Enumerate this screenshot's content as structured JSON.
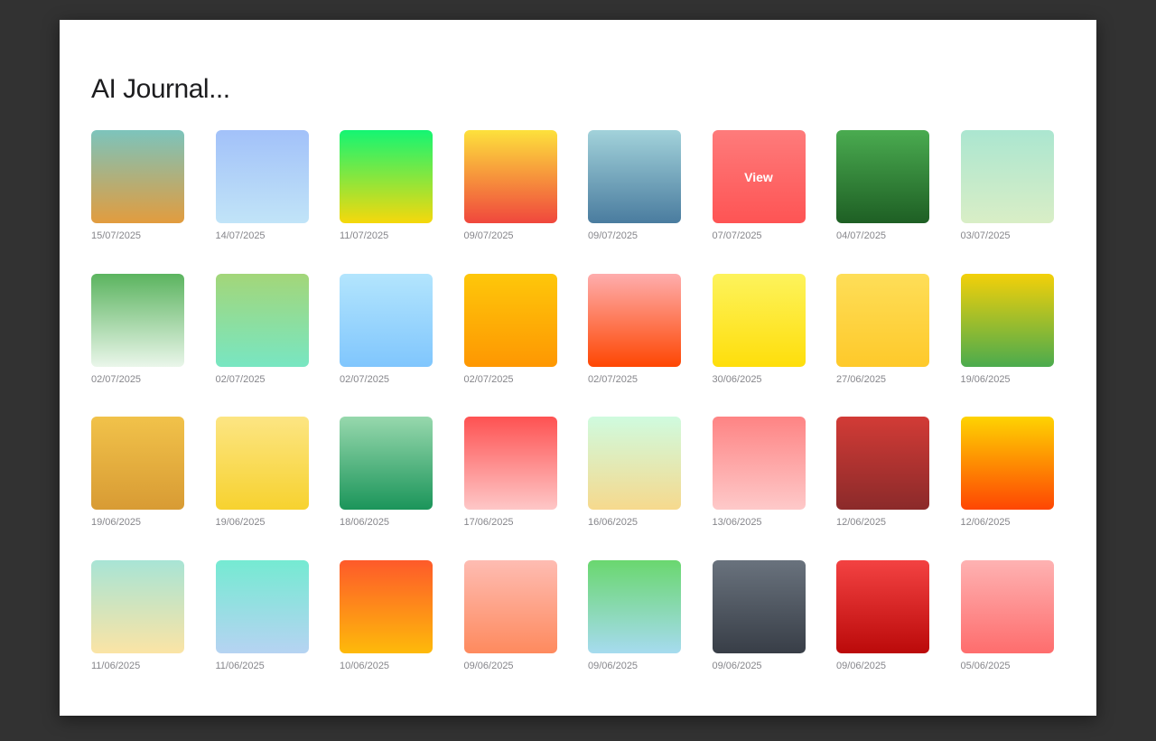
{
  "page": {
    "title": "AI Journal..."
  },
  "hover_label": "View",
  "entries": [
    {
      "date": "15/07/2025",
      "gradient": [
        "#7cc4bc",
        "#e29c3e"
      ]
    },
    {
      "date": "14/07/2025",
      "gradient": [
        "#a2c1f9",
        "#c1e4f8"
      ]
    },
    {
      "date": "11/07/2025",
      "gradient": [
        "#14f573",
        "#f6d80c"
      ]
    },
    {
      "date": "09/07/2025",
      "gradient": [
        "#fde13c",
        "#f0473d"
      ]
    },
    {
      "date": "09/07/2025",
      "gradient": [
        "#a2d2da",
        "#4a7c9f"
      ]
    },
    {
      "date": "07/07/2025",
      "gradient": [
        "#fe7b7b",
        "#fe5454"
      ],
      "hovered": true
    },
    {
      "date": "04/07/2025",
      "gradient": [
        "#4aab50",
        "#1e5f24"
      ]
    },
    {
      "date": "03/07/2025",
      "gradient": [
        "#abe6d0",
        "#d9eec6"
      ]
    },
    {
      "date": "02/07/2025",
      "gradient": [
        "#5bb45f",
        "#eaf6ea"
      ]
    },
    {
      "date": "02/07/2025",
      "gradient": [
        "#a3d679",
        "#78e6c2"
      ]
    },
    {
      "date": "02/07/2025",
      "gradient": [
        "#b3e5fd",
        "#80c6fd"
      ]
    },
    {
      "date": "02/07/2025",
      "gradient": [
        "#fec70a",
        "#fe9702"
      ]
    },
    {
      "date": "02/07/2025",
      "gradient": [
        "#feadad",
        "#fe4703"
      ]
    },
    {
      "date": "30/06/2025",
      "gradient": [
        "#fdf35c",
        "#fede0b"
      ]
    },
    {
      "date": "27/06/2025",
      "gradient": [
        "#fede58",
        "#fec92a"
      ]
    },
    {
      "date": "19/06/2025",
      "gradient": [
        "#f3d009",
        "#4bab4e"
      ]
    },
    {
      "date": "19/06/2025",
      "gradient": [
        "#f1c24a",
        "#d89b34"
      ]
    },
    {
      "date": "19/06/2025",
      "gradient": [
        "#fce583",
        "#f7d22f"
      ]
    },
    {
      "date": "18/06/2025",
      "gradient": [
        "#97d8ad",
        "#1b955a"
      ]
    },
    {
      "date": "17/06/2025",
      "gradient": [
        "#fe5252",
        "#fec7c7"
      ]
    },
    {
      "date": "16/06/2025",
      "gradient": [
        "#cffbdf",
        "#f6d98d"
      ]
    },
    {
      "date": "13/06/2025",
      "gradient": [
        "#fe8484",
        "#fec9c9"
      ]
    },
    {
      "date": "12/06/2025",
      "gradient": [
        "#d23b36",
        "#8b2a2a"
      ]
    },
    {
      "date": "12/06/2025",
      "gradient": [
        "#fed302",
        "#fe4603"
      ]
    },
    {
      "date": "11/06/2025",
      "gradient": [
        "#a8e4d5",
        "#fbe4a5"
      ]
    },
    {
      "date": "11/06/2025",
      "gradient": [
        "#75ead2",
        "#b6d3f2"
      ]
    },
    {
      "date": "10/06/2025",
      "gradient": [
        "#fe5a2a",
        "#feba0a"
      ]
    },
    {
      "date": "09/06/2025",
      "gradient": [
        "#febcb2",
        "#fe8a5e"
      ]
    },
    {
      "date": "09/06/2025",
      "gradient": [
        "#6ad76f",
        "#a6dbef"
      ]
    },
    {
      "date": "09/06/2025",
      "gradient": [
        "#69727d",
        "#383e47"
      ]
    },
    {
      "date": "09/06/2025",
      "gradient": [
        "#f34242",
        "#bb0a0a"
      ]
    },
    {
      "date": "05/06/2025",
      "gradient": [
        "#feb2b2",
        "#fe6d6d"
      ]
    }
  ]
}
